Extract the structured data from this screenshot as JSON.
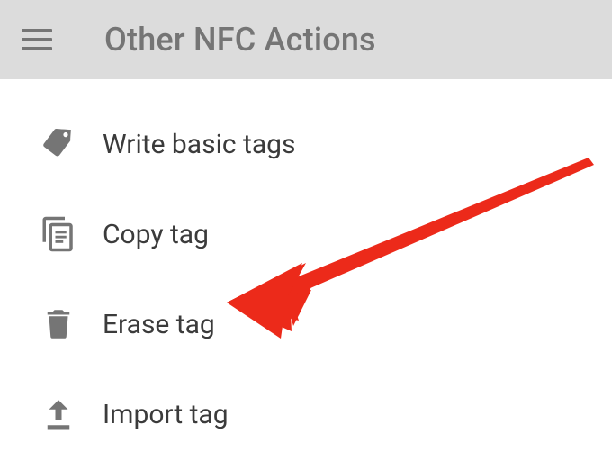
{
  "appbar": {
    "title": "Other NFC Actions"
  },
  "menu": {
    "items": [
      {
        "label": "Write basic tags",
        "icon": "tags-icon"
      },
      {
        "label": "Copy tag",
        "icon": "copy-icon"
      },
      {
        "label": "Erase tag",
        "icon": "trash-icon"
      },
      {
        "label": "Import tag",
        "icon": "upload-icon"
      }
    ]
  },
  "annotation": {
    "arrow_color": "#ec2a1a",
    "target_item_index": 2
  }
}
